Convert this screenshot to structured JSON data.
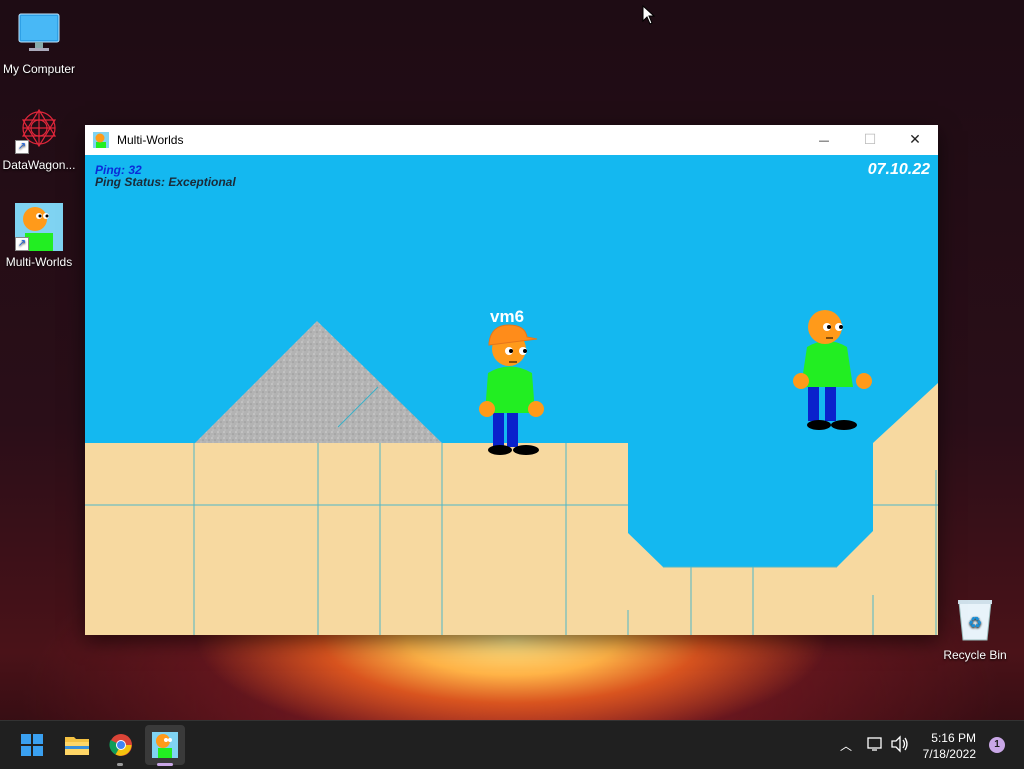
{
  "desktop": {
    "icons": [
      {
        "label": "My Computer",
        "icon": "monitor-icon"
      },
      {
        "label": "DataWagon...",
        "icon": "datawagon-logo-icon"
      },
      {
        "label": "Multi-Worlds",
        "icon": "multi-worlds-character-icon"
      },
      {
        "label": "Recycle Bin",
        "icon": "recycle-bin-icon"
      }
    ]
  },
  "window": {
    "title": "Multi-Worlds",
    "controls": {
      "minimize": "—",
      "maximize": "☐",
      "close": "✕"
    }
  },
  "game": {
    "ping_text": "Ping: 32",
    "ping_status_text": "Ping Status: Exceptional",
    "date": "07.10.22",
    "player_name": "vm6",
    "colors": {
      "sky": "#14b8f0",
      "sand": "#f7d9a0",
      "stone": "#b8b8b8",
      "skin": "#ff9a1a",
      "shirt": "#22ee22",
      "pants": "#0a22cc"
    }
  },
  "taskbar": {
    "apps": [
      "start-icon",
      "file-explorer-icon",
      "chrome-icon",
      "multi-worlds-icon"
    ],
    "time": "5:16 PM",
    "date": "7/18/2022",
    "notification_count": "1"
  }
}
